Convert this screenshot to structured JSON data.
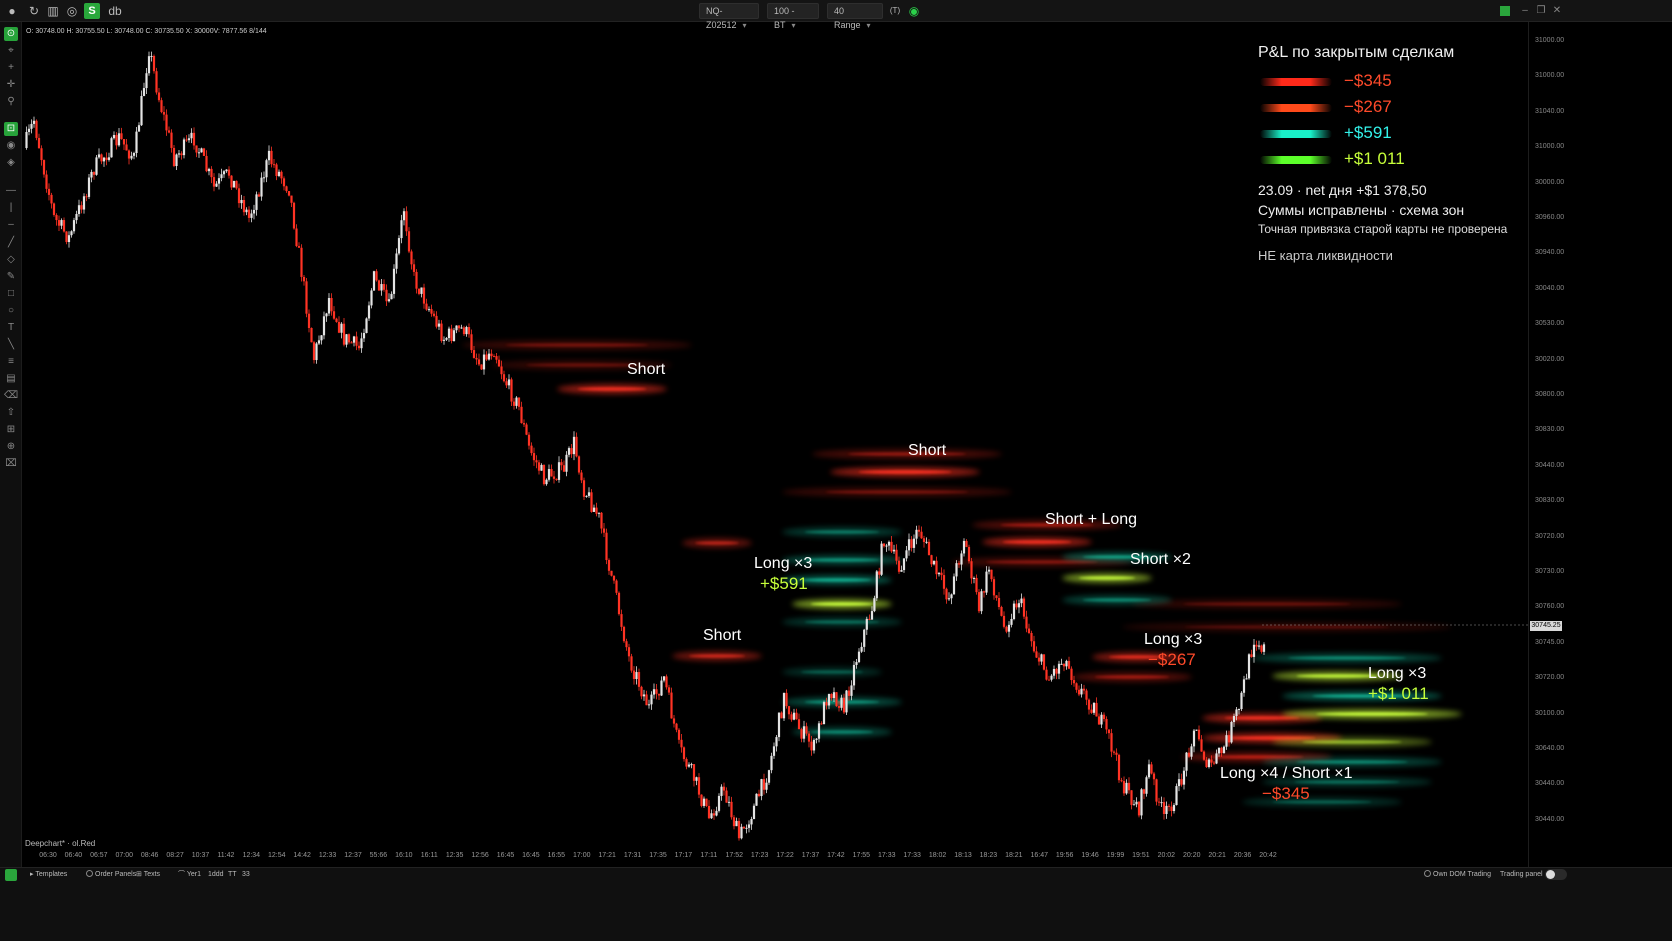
{
  "toolbar": {
    "symbol": "NQ-Z02512",
    "bars": "100 - BT",
    "range": "40 Range",
    "extra": "(T)",
    "app_label": "db"
  },
  "ohlc_readout": "O: 30748.00  H: 30755.50  L: 30748.00  C: 30735.50  X: 30000V: 7877.56  8/144",
  "chart_name": "Deepchart* · ol.Red",
  "current_price": "30745.25",
  "price_ticks": [
    "31000.00",
    "31000.00",
    "31040.00",
    "31000.00",
    "30000.00",
    "30960.00",
    "30940.00",
    "30040.00",
    "30530.00",
    "30020.00",
    "30800.00",
    "30830.00",
    "30440.00",
    "30830.00",
    "30720.00",
    "30730.00",
    "30760.00",
    "30745.00",
    "30720.00",
    "30100.00",
    "30640.00",
    "30440.00",
    "30440.00"
  ],
  "time_ticks": [
    "06:30",
    "06:40",
    "06:57",
    "07:00",
    "08:46",
    "08:27",
    "10:37",
    "11:42",
    "12:34",
    "12:54",
    "14:42",
    "12:33",
    "12:37",
    "55:66",
    "16:10",
    "16:11",
    "12:35",
    "12:56",
    "16:45",
    "16:45",
    "16:55",
    "17:00",
    "17:21",
    "17:31",
    "17:35",
    "17:17",
    "17:11",
    "17:52",
    "17:23",
    "17:22",
    "17:37",
    "17:42",
    "17:55",
    "17:33",
    "17:33",
    "18:02",
    "18:13",
    "18:23",
    "18:21",
    "16:47",
    "19:56",
    "19:46",
    "19:99",
    "19:51",
    "20:02",
    "20:20",
    "20:21",
    "20:36",
    "20:42"
  ],
  "bottom": {
    "templates": "Templates",
    "order_panels": "Order Panels",
    "texts": "Texts",
    "misc1": "Yer1",
    "misc2": "1ddd",
    "misc3": "TT",
    "misc4": "33",
    "dom_trading": "Own DOM Trading",
    "trading_panel": "Trading panel"
  },
  "legend": {
    "title": "P&L по закрытым сделкам",
    "rows": [
      {
        "amount": "−$345",
        "color": "#ff2a1a"
      },
      {
        "amount": "−$267",
        "color": "#ff4a1a"
      },
      {
        "amount": "+$591",
        "color": "#19f0c8"
      },
      {
        "amount": "+$1 011",
        "color": "#5cff2a"
      }
    ],
    "net": "23.09 · net дня +$1 378,50",
    "fixed": "Суммы исправлены · схема зон",
    "note": "Точная привязка старой карты не проверена",
    "not_liquidity": "НЕ карта ликвидности"
  },
  "annotations": {
    "short1": "Short",
    "short2": "Short",
    "short3": "Short",
    "short_long": "Short + Long",
    "short_x2": "Short ×2",
    "long3_a": "Long ×3",
    "long3_a_val": "+$591",
    "long3_b": "Long ×3",
    "long3_b_val": "−$267",
    "long3_c": "Long ×3",
    "long3_c_val": "+$1 011",
    "long4": "Long ×4 / Short ×1",
    "long4_val": "−$345"
  },
  "colors": {
    "up": "#e8e8e8",
    "down": "#ff3020",
    "positive": "#c7ff3a",
    "negative": "#ff4a2a"
  }
}
